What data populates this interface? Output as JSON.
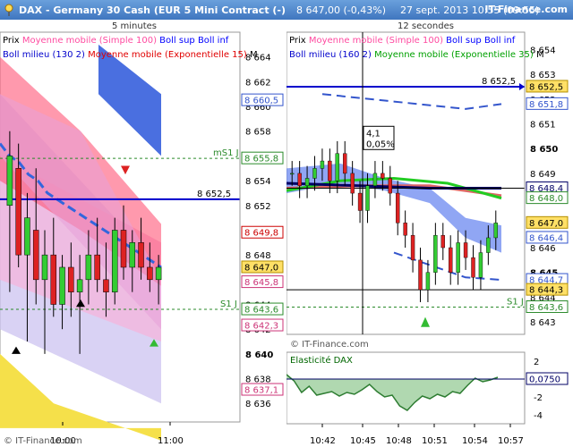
{
  "header": {
    "title": "DAX - Germany 30 Cash (EUR 5 Mini Contract (-)",
    "price": "8 647,00 (-0,43%)",
    "date": "27 sept. 2013 10:55 (09:55)",
    "brand": "IT-Finance.com",
    "pin_icon": "pushpin-icon"
  },
  "left": {
    "timeframe": "5 minutes",
    "legend1": [
      {
        "text": "Prix",
        "color": "#000000"
      },
      {
        "text": "Moyenne mobile (Simple 100)",
        "color": "#ff4aa0"
      },
      {
        "text": "Boll sup Boll inf",
        "color": "#0000ff"
      }
    ],
    "legend2": [
      {
        "text": "Boll milieu (130 2)",
        "color": "#0000cc"
      },
      {
        "text": "Moyenne mobile (Exponentielle 15)",
        "color": "#e00000"
      },
      {
        "text": "M",
        "color": "#000000"
      }
    ],
    "axis_ticks": [
      "8 664",
      "8 662",
      "8 660",
      "8 658",
      "8 656",
      "8 654",
      "8 652",
      "8 650",
      "8 648",
      "8 646",
      "8 644",
      "8 642",
      "8 640",
      "8 638",
      "8 636"
    ],
    "time_labels": [
      "10:00",
      "11:00"
    ],
    "line_label": "8 652,5",
    "ms1_label": "mS1 J",
    "s1_label": "S1 J",
    "badges": [
      {
        "text": "8 660,5",
        "v": 8660.5,
        "bg": "#ffffff",
        "fg": "#3355cc",
        "border": "#3355cc"
      },
      {
        "text": "8 655,8",
        "v": 8655.8,
        "bg": "#ffffff",
        "fg": "#2a8a2a",
        "border": "#2a8a2a"
      },
      {
        "text": "8 649,8",
        "v": 8649.8,
        "bg": "#ffffff",
        "fg": "#cc0000",
        "border": "#cc0000"
      },
      {
        "text": "8 647,0",
        "v": 8647.0,
        "bg": "#ffe066",
        "fg": "#000000",
        "border": "#b38f00"
      },
      {
        "text": "8 645,8",
        "v": 8645.8,
        "bg": "#ffffff",
        "fg": "#cc3377",
        "border": "#cc3377"
      },
      {
        "text": "8 643,6",
        "v": 8643.6,
        "bg": "#ffffff",
        "fg": "#2a8a2a",
        "border": "#2a8a2a"
      },
      {
        "text": "8 642,3",
        "v": 8642.3,
        "bg": "#ffffff",
        "fg": "#cc3377",
        "border": "#cc3377"
      },
      {
        "text": "8 637,1",
        "v": 8637.1,
        "bg": "#ffffff",
        "fg": "#cc3377",
        "border": "#cc3377"
      }
    ],
    "watermark": "© IT-Finance.com"
  },
  "right": {
    "timeframe": "12 secondes",
    "legend1": [
      {
        "text": "Prix",
        "color": "#000000"
      },
      {
        "text": "Moyenne mobile (Simple 100)",
        "color": "#ff4aa0"
      },
      {
        "text": "Boll sup Boll inf",
        "color": "#0000ff"
      }
    ],
    "legend2": [
      {
        "text": "Boll milieu (160 2)",
        "color": "#0000cc"
      },
      {
        "text": "Moyenne mobile (Exponentielle 35)",
        "color": "#00a000"
      },
      {
        "text": "M",
        "color": "#000000"
      }
    ],
    "axis_ticks": [
      "8 654",
      "8 653",
      "8 652",
      "8 651",
      "8 650",
      "8 649",
      "8 648",
      "8 647",
      "8 646",
      "8 645",
      "8 644",
      "8 643"
    ],
    "time_labels": [
      "10:42",
      "10:45",
      "10:48",
      "10:51",
      "10:54",
      "10:57"
    ],
    "line_label": "8 652,5",
    "s1_label": "S1 J",
    "crosshair_box": [
      "4,1",
      "0,05%"
    ],
    "badges": [
      {
        "text": "8 652,5",
        "v": 8652.5,
        "bg": "#ffe066",
        "fg": "#000000",
        "border": "#b38f00"
      },
      {
        "text": "8 651,8",
        "v": 8651.8,
        "bg": "#ffffff",
        "fg": "#3355cc",
        "border": "#3355cc"
      },
      {
        "text": "8 648,4",
        "v": 8648.4,
        "bg": "#ffffff",
        "fg": "#000066",
        "border": "#000066"
      },
      {
        "text": "8 648,0",
        "v": 8648.0,
        "bg": "#ffffff",
        "fg": "#2a8a2a",
        "border": "#2a8a2a"
      },
      {
        "text": "8 647,0",
        "v": 8647.0,
        "bg": "#ffe066",
        "fg": "#000000",
        "border": "#b38f00"
      },
      {
        "text": "8 646,4",
        "v": 8646.4,
        "bg": "#ffffff",
        "fg": "#3355cc",
        "border": "#3355cc"
      },
      {
        "text": "8 644,7",
        "v": 8644.7,
        "bg": "#ffffff",
        "fg": "#3355cc",
        "border": "#3355cc"
      },
      {
        "text": "8 644,3",
        "v": 8644.3,
        "bg": "#ffe066",
        "fg": "#000000",
        "border": "#b38f00"
      },
      {
        "text": "8 643,6",
        "v": 8643.6,
        "bg": "#ffffff",
        "fg": "#2a8a2a",
        "border": "#2a8a2a"
      }
    ],
    "watermark": "© IT-Finance.com",
    "indicator": {
      "title": "Elasticité DAX",
      "ticks": [
        "2",
        "0",
        "-2",
        "-4"
      ],
      "value_badge": "0,0750"
    }
  },
  "chart_data": [
    {
      "type": "candlestick",
      "title": "5 minutes",
      "ylim": [
        8634.5,
        8666
      ],
      "series": [
        {
          "name": "Prix",
          "ohlc": [
            [
              8652,
              8658,
              8645,
              8656
            ],
            [
              8655,
              8657,
              8647,
              8648
            ],
            [
              8648,
              8653,
              8641,
              8651
            ],
            [
              8650,
              8655,
              8644,
              8646
            ],
            [
              8646,
              8650,
              8640,
              8648
            ],
            [
              8648,
              8651,
              8643,
              8644
            ],
            [
              8644,
              8648,
              8642,
              8647
            ],
            [
              8647,
              8649,
              8643,
              8645
            ],
            [
              8645,
              8648,
              8640,
              8646
            ],
            [
              8646,
              8650,
              8644,
              8648
            ],
            [
              8648,
              8651,
              8645,
              8646
            ],
            [
              8646,
              8649,
              8643,
              8645
            ],
            [
              8645,
              8651,
              8644,
              8650
            ],
            [
              8650,
              8652,
              8646,
              8647
            ],
            [
              8647,
              8650,
              8645,
              8649
            ],
            [
              8649,
              8651,
              8646,
              8647
            ],
            [
              8647,
              8649,
              8645,
              8646
            ],
            [
              8646,
              8648,
              8644,
              8647
            ]
          ]
        },
        {
          "name": "Boll milieu (130 2)",
          "values": [
            8657,
            8656,
            8655.5,
            8654.5,
            8654,
            8653,
            8652.5,
            8652,
            8651.5,
            8651,
            8650.5,
            8650,
            8649.5,
            8649,
            8648.5,
            8648,
            8647.5,
            8647
          ]
        }
      ],
      "horizontal_lines": [
        8652.5,
        8655.8,
        8643.6
      ]
    },
    {
      "type": "candlestick",
      "title": "12 secondes",
      "ylim": [
        8642.5,
        8654.7
      ],
      "series": [
        {
          "name": "Prix",
          "close": [
            8649,
            8648.5,
            8648.8,
            8649.2,
            8649.5,
            8648.7,
            8649.8,
            8649,
            8648.2,
            8647.5,
            8648.5,
            8649,
            8648.8,
            8648.2,
            8647,
            8646.5,
            8645.5,
            8644.3,
            8645,
            8646.5,
            8646,
            8645,
            8646.2,
            8645.6,
            8644.8,
            8645.8,
            8646.4,
            8647
          ]
        },
        {
          "name": "Moyenne mobile (Exponentielle 35)",
          "values": [
            8648.5,
            8648.5,
            8648.6,
            8648.7,
            8648.8,
            8648.8,
            8648.9,
            8648.9,
            8648.8,
            8648.8,
            8648.7,
            8648.7,
            8648.7,
            8648.6,
            8648.5,
            8648.4,
            8648.2,
            8648.1,
            8648,
            8648
          ]
        }
      ],
      "horizontal_lines": [
        8652.5,
        8648.4,
        8644.3,
        8643.6
      ]
    },
    {
      "type": "area",
      "title": "Elasticité DAX",
      "ylim": [
        -5,
        3
      ],
      "values": [
        0.5,
        -0.2,
        -1.5,
        -0.8,
        -1.8,
        -1.6,
        -1.4,
        -1.9,
        -1.5,
        -1.7,
        -1.2,
        -0.6,
        -1.4,
        -2,
        -1.8,
        -3,
        -3.5,
        -2.6,
        -1.9,
        -2.2,
        -1.7,
        -2,
        -1.4,
        -1.6,
        -0.7,
        0.1,
        -0.3,
        -0.1,
        0.2
      ]
    }
  ]
}
